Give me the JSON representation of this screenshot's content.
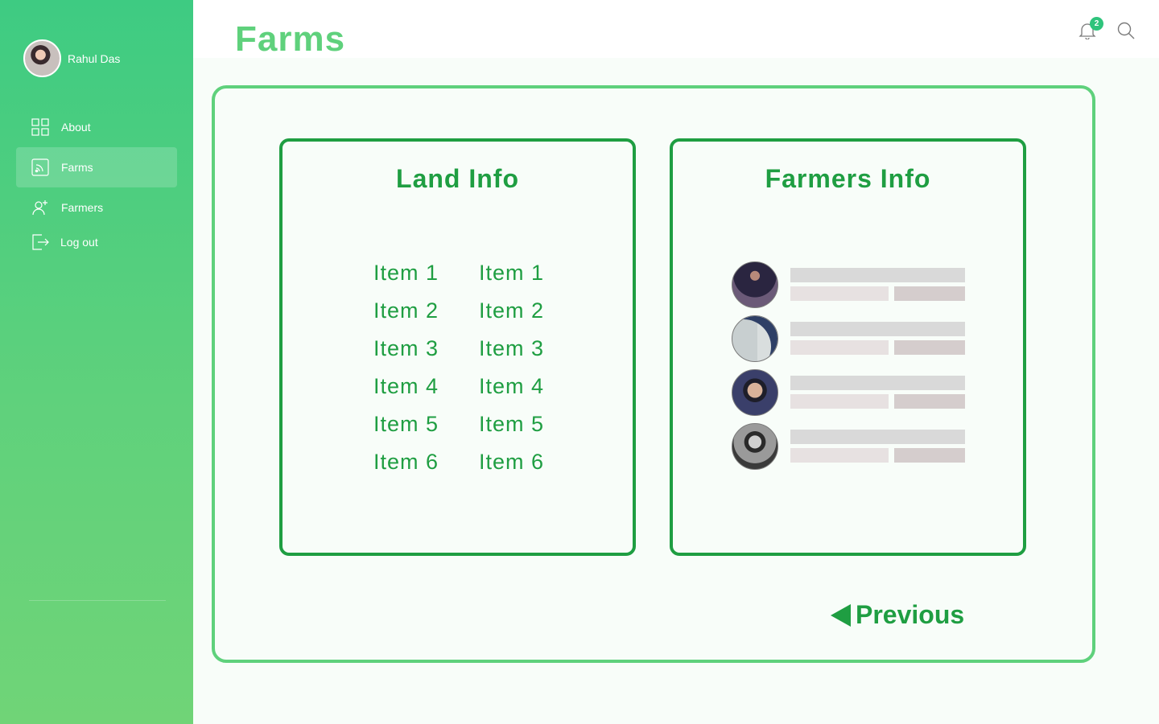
{
  "user": {
    "name": "Rahul Das"
  },
  "sidebar": {
    "items": [
      {
        "label": "About",
        "icon": "grid-icon",
        "active": false
      },
      {
        "label": "Farms",
        "icon": "rss-icon",
        "active": true
      },
      {
        "label": "Farmers",
        "icon": "add-user-icon",
        "active": false
      },
      {
        "label": "Log out",
        "icon": "logout-icon",
        "active": false
      }
    ]
  },
  "header": {
    "title": "Farms",
    "notifications_count": "2"
  },
  "land_info": {
    "title": "Land Info",
    "column1": [
      "Item 1",
      "Item 2",
      "Item 3",
      "Item 4",
      "Item 5",
      "Item 6"
    ],
    "column2": [
      "Item 1",
      "Item 2",
      "Item 3",
      "Item 4",
      "Item 5",
      "Item 6"
    ]
  },
  "farmers_info": {
    "title": "Farmers Info",
    "farmers": [
      {
        "avatar": "farmer-photo-1"
      },
      {
        "avatar": "farmer-photo-2"
      },
      {
        "avatar": "farmer-photo-3"
      },
      {
        "avatar": "farmer-photo-4"
      }
    ]
  },
  "navigation": {
    "previous_label": "Previous"
  },
  "colors": {
    "sidebar_top": "#3ecb82",
    "sidebar_bottom": "#70d477",
    "accent_dark": "#1f9e42",
    "accent_light": "#5fd17c",
    "badge": "#2fc47c"
  }
}
